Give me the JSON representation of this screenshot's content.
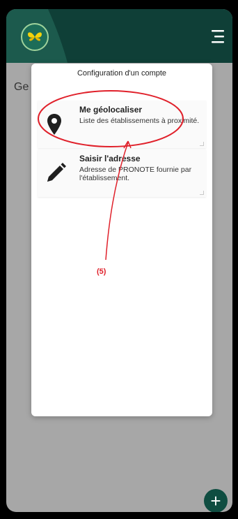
{
  "behind": {
    "partial_text": "Ge"
  },
  "modal": {
    "title": "Configuration d'un compte",
    "options": [
      {
        "title": "Me géolocaliser",
        "description": "Liste des établissements à proximité.",
        "icon": "location-pin-icon"
      },
      {
        "title": "Saisir l'adresse",
        "description": "Adresse de PRONOTE fournie par l'établissement.",
        "icon": "pencil-icon"
      }
    ]
  },
  "fab": {
    "label": "+"
  },
  "annotation": {
    "label": "(5)",
    "color": "#e0202a"
  },
  "colors": {
    "header": "#0f3f37",
    "accent": "#0f4d41",
    "logo_leaf": "#f4d20b"
  }
}
